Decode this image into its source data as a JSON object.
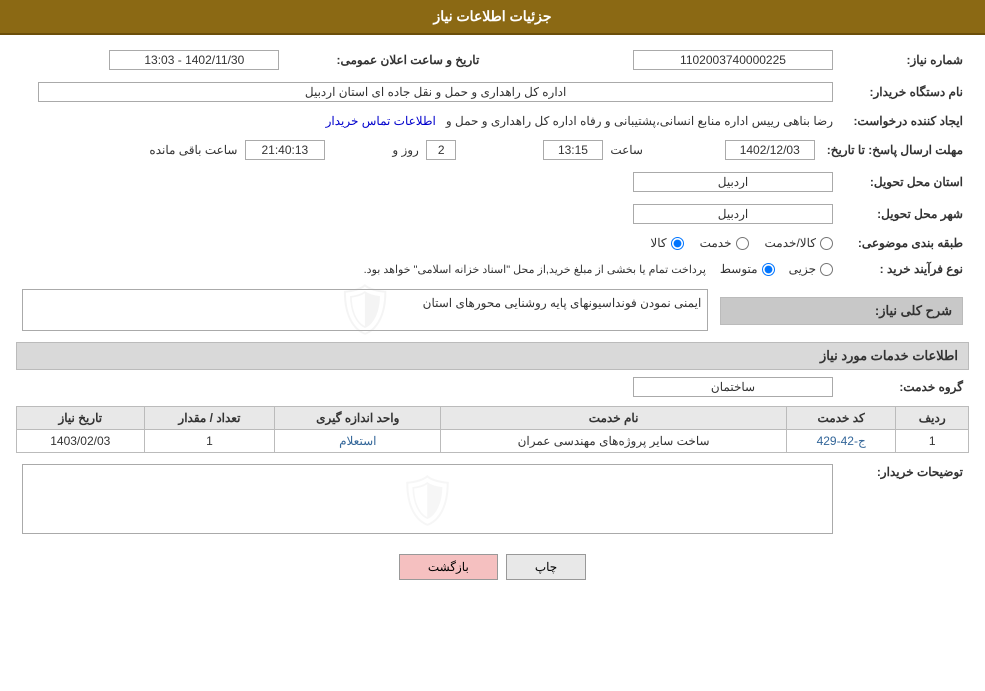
{
  "header": {
    "title": "جزئیات اطلاعات نیاز"
  },
  "fields": {
    "need_number_label": "شماره نیاز:",
    "need_number_value": "1102003740000225",
    "buyer_org_label": "نام دستگاه خریدار:",
    "buyer_org_value": "اداره کل راهداری و حمل و نقل جاده ای استان اردبیل",
    "requester_label": "ایجاد کننده درخواست:",
    "requester_value": "رضا بناهی رییس اداره منابع انسانی،پشتیبانی و رفاه اداره کل راهداری و حمل و",
    "requester_link": "اطلاعات تماس خریدار",
    "deadline_label": "مهلت ارسال پاسخ: تا تاریخ:",
    "deadline_date": "1402/12/03",
    "deadline_time": "13:15",
    "deadline_days": "2",
    "deadline_counter": "21:40:13",
    "deadline_remaining": "ساعت باقی مانده",
    "deadline_days_label": "روز و",
    "announce_label": "تاریخ و ساعت اعلان عمومی:",
    "announce_value": "1402/11/30 - 13:03",
    "province_label": "استان محل تحویل:",
    "province_value": "اردبیل",
    "city_label": "شهر محل تحویل:",
    "city_value": "اردبیل",
    "category_label": "طبقه بندی موضوعی:",
    "category_goods": "کالا",
    "category_service": "خدمت",
    "category_goods_service": "کالا/خدمت",
    "process_label": "نوع فرآیند خرید :",
    "process_partial": "جزیی",
    "process_medium": "متوسط",
    "process_full": "پرداخت تمام یا بخشی از مبلغ خرید,از محل \"اسناد خزانه اسلامی\" خواهد بود.",
    "description_label": "شرح کلی نیاز:",
    "description_value": "ایمنی نمودن فونداسیونهای پایه روشنایی محورهای استان",
    "services_section_label": "اطلاعات خدمات مورد نیاز",
    "service_group_label": "گروه خدمت:",
    "service_group_value": "ساختمان",
    "table_headers": {
      "row": "ردیف",
      "code": "کد خدمت",
      "name": "نام خدمت",
      "unit": "واحد اندازه گیری",
      "qty": "تعداد / مقدار",
      "date": "تاریخ نیاز"
    },
    "table_rows": [
      {
        "row": "1",
        "code": "ج-42-429",
        "name": "ساخت سایر پروژه‌های مهندسی عمران",
        "unit": "استعلام",
        "qty": "1",
        "date": "1403/02/03"
      }
    ],
    "buyer_notes_label": "توضیحات خریدار:",
    "buyer_notes_value": ""
  },
  "buttons": {
    "print": "چاپ",
    "back": "بازگشت"
  }
}
